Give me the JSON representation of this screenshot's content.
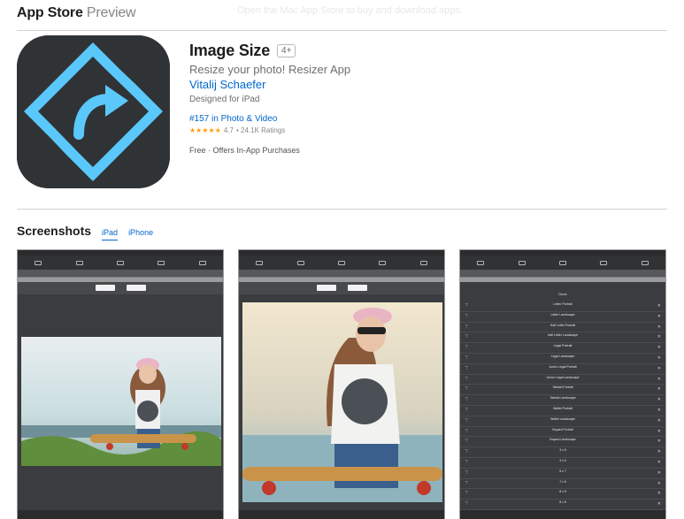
{
  "header": {
    "brand": "App Store",
    "brand_suffix": "Preview",
    "banner_text": "Open the Mac App Store to buy and download apps."
  },
  "app": {
    "title": "Image Size",
    "age_rating": "4+",
    "subtitle": "Resize your photo! Resizer App",
    "developer": "Vitalij Schaefer",
    "designed_for": "Designed for iPad",
    "rank": "#157 in Photo & Video",
    "stars": "★★★★★",
    "rating_value": "4.7",
    "rating_count": "• 24.1K Ratings",
    "price": "Free · Offers In-App Purchases",
    "icon_name": "image-size-app-icon",
    "icon_colors": {
      "background": "#303336",
      "accent": "#5ac8fa"
    }
  },
  "screenshots": {
    "title": "Screenshots",
    "tabs": [
      {
        "label": "iPad",
        "active": true
      },
      {
        "label": "iPhone",
        "active": false
      }
    ],
    "list_items": [
      "Done",
      "Letter Portrait",
      "Letter Landscape",
      "Half Letter Portrait",
      "Half Letter Landscape",
      "Legal Portrait",
      "Legal Landscape",
      "Junior Legal Portrait",
      "Junior Legal Landscape",
      "Tabloid Portrait",
      "Tabloid Landscape",
      "Wallet Portrait",
      "Wallet Landscape",
      "Boyard Portrait",
      "Boyard Landscape",
      "3 x 5",
      "4 x 6",
      "5 x 7",
      "7 x 5",
      "8 x 8",
      "8 x 8",
      "8 x 10"
    ]
  }
}
